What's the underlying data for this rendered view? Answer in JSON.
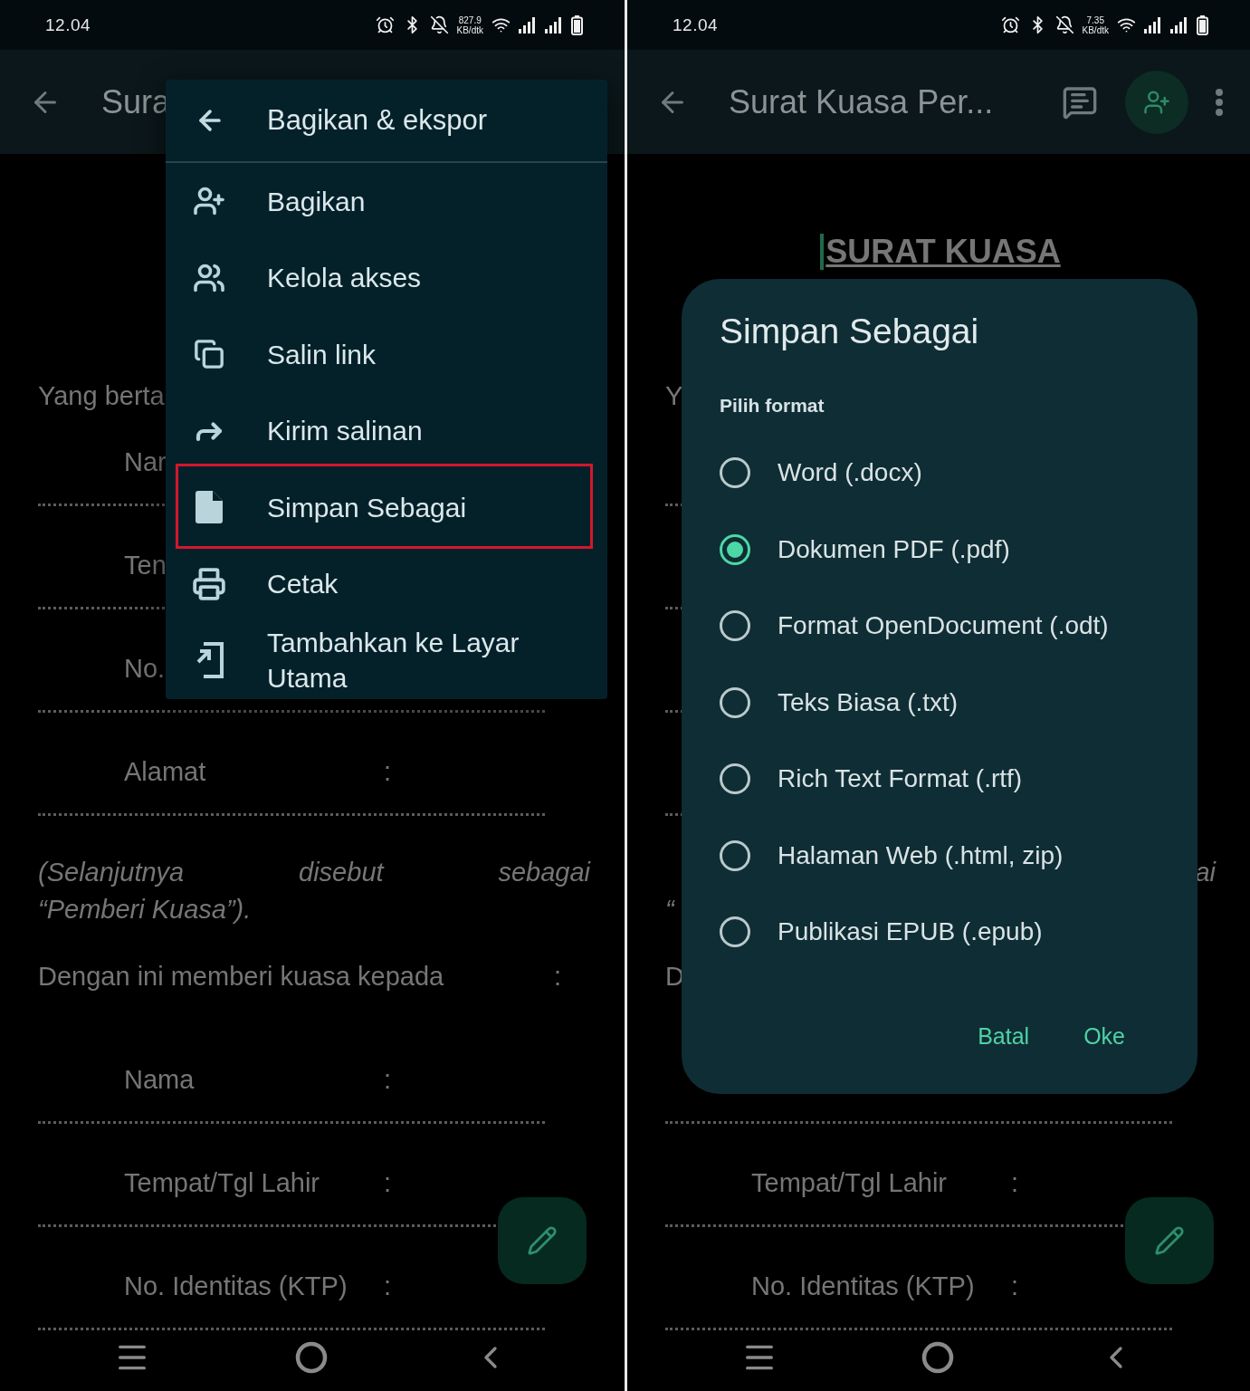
{
  "phones": [
    {
      "status_bar": {
        "time": "12.04",
        "speed": "827.9",
        "speed_unit": "KB/dtk"
      },
      "app_bar": {
        "title": "Sura"
      },
      "document": {
        "lines": [
          {
            "kind": "heading",
            "text": "Yang berta"
          },
          {
            "kind": "field",
            "label": "Nar"
          },
          {
            "kind": "dots"
          },
          {
            "kind": "field",
            "label": "Ten"
          },
          {
            "kind": "dots"
          },
          {
            "kind": "field",
            "label": "No."
          },
          {
            "kind": "dots"
          },
          {
            "kind": "field",
            "label": "Alamat",
            "colon": ":"
          },
          {
            "kind": "dots"
          },
          {
            "kind": "para",
            "lines": [
              {
                "words": [
                  "(Selanjutnya",
                  "disebut",
                  "sebagai"
                ],
                "right_aligned": false
              },
              {
                "words": [
                  "“Pemberi Kuasa”)."
                ],
                "right_aligned": false
              }
            ]
          },
          {
            "kind": "statement",
            "text": "Dengan ini memberi kuasa kepada",
            "colon": ":"
          },
          {
            "kind": "field",
            "label": "Nama",
            "colon": ":"
          },
          {
            "kind": "dots"
          },
          {
            "kind": "field",
            "label": "Tempat/Tgl Lahir",
            "colon": ":"
          },
          {
            "kind": "dots"
          },
          {
            "kind": "field",
            "label": "No. Identitas (KTP)",
            "colon": ":"
          },
          {
            "kind": "dots"
          }
        ]
      },
      "menu": {
        "title": "Bagikan & ekspor",
        "items": [
          {
            "kind": "share",
            "label": "Bagikan",
            "highlighted": false
          },
          {
            "kind": "access",
            "label": "Kelola akses",
            "highlighted": false
          },
          {
            "kind": "copy",
            "label": "Salin link",
            "highlighted": false
          },
          {
            "kind": "send",
            "label": "Kirim salinan",
            "highlighted": false
          },
          {
            "kind": "save",
            "label": "Simpan Sebagai",
            "highlighted": true
          },
          {
            "kind": "print",
            "label": "Cetak",
            "highlighted": false
          },
          {
            "kind": "home",
            "label": "Tambahkan ke Layar Utama",
            "highlighted": false
          }
        ]
      }
    },
    {
      "status_bar": {
        "time": "12.04",
        "speed": "7.35",
        "speed_unit": "KB/dtk"
      },
      "app_bar": {
        "title": "Surat Kuasa Per...",
        "actions": [
          {
            "kind": "comment"
          },
          {
            "kind": "share"
          },
          {
            "kind": "more"
          }
        ]
      },
      "document": {
        "title": "SURAT KUASA",
        "lines": [
          {
            "kind": "heading",
            "text": "Y"
          },
          {
            "kind": "field"
          },
          {
            "kind": "dots"
          },
          {
            "kind": "field"
          },
          {
            "kind": "dots"
          },
          {
            "kind": "field"
          },
          {
            "kind": "dots"
          },
          {
            "kind": "field"
          },
          {
            "kind": "dots"
          },
          {
            "kind": "para",
            "lines": [
              {
                "words": [
                  "ai"
                ],
                "right_aligned": true
              },
              {
                "words": [
                  "“"
                ],
                "right_aligned": false
              }
            ]
          },
          {
            "kind": "statement",
            "text": "D"
          },
          {
            "kind": "field"
          },
          {
            "kind": "dots"
          },
          {
            "kind": "field",
            "label": "Tempat/Tgl Lahir",
            "colon": ":"
          },
          {
            "kind": "dots"
          },
          {
            "kind": "field",
            "label": "No. Identitas (KTP)",
            "colon": ":"
          },
          {
            "kind": "dots"
          }
        ]
      },
      "dialog": {
        "title": "Simpan Sebagai",
        "subtitle": "Pilih format",
        "options": [
          {
            "label": "Word (.docx)",
            "selected": false
          },
          {
            "label": "Dokumen PDF (.pdf)",
            "selected": true
          },
          {
            "label": "Format OpenDocument (.odt)",
            "selected": false
          },
          {
            "label": "Teks Biasa (.txt)",
            "selected": false
          },
          {
            "label": "Rich Text Format (.rtf)",
            "selected": false
          },
          {
            "label": "Halaman Web (.html, zip)",
            "selected": false
          },
          {
            "label": "Publikasi EPUB (.epub)",
            "selected": false
          }
        ],
        "buttons": [
          "Batal",
          "Oke"
        ]
      }
    }
  ]
}
